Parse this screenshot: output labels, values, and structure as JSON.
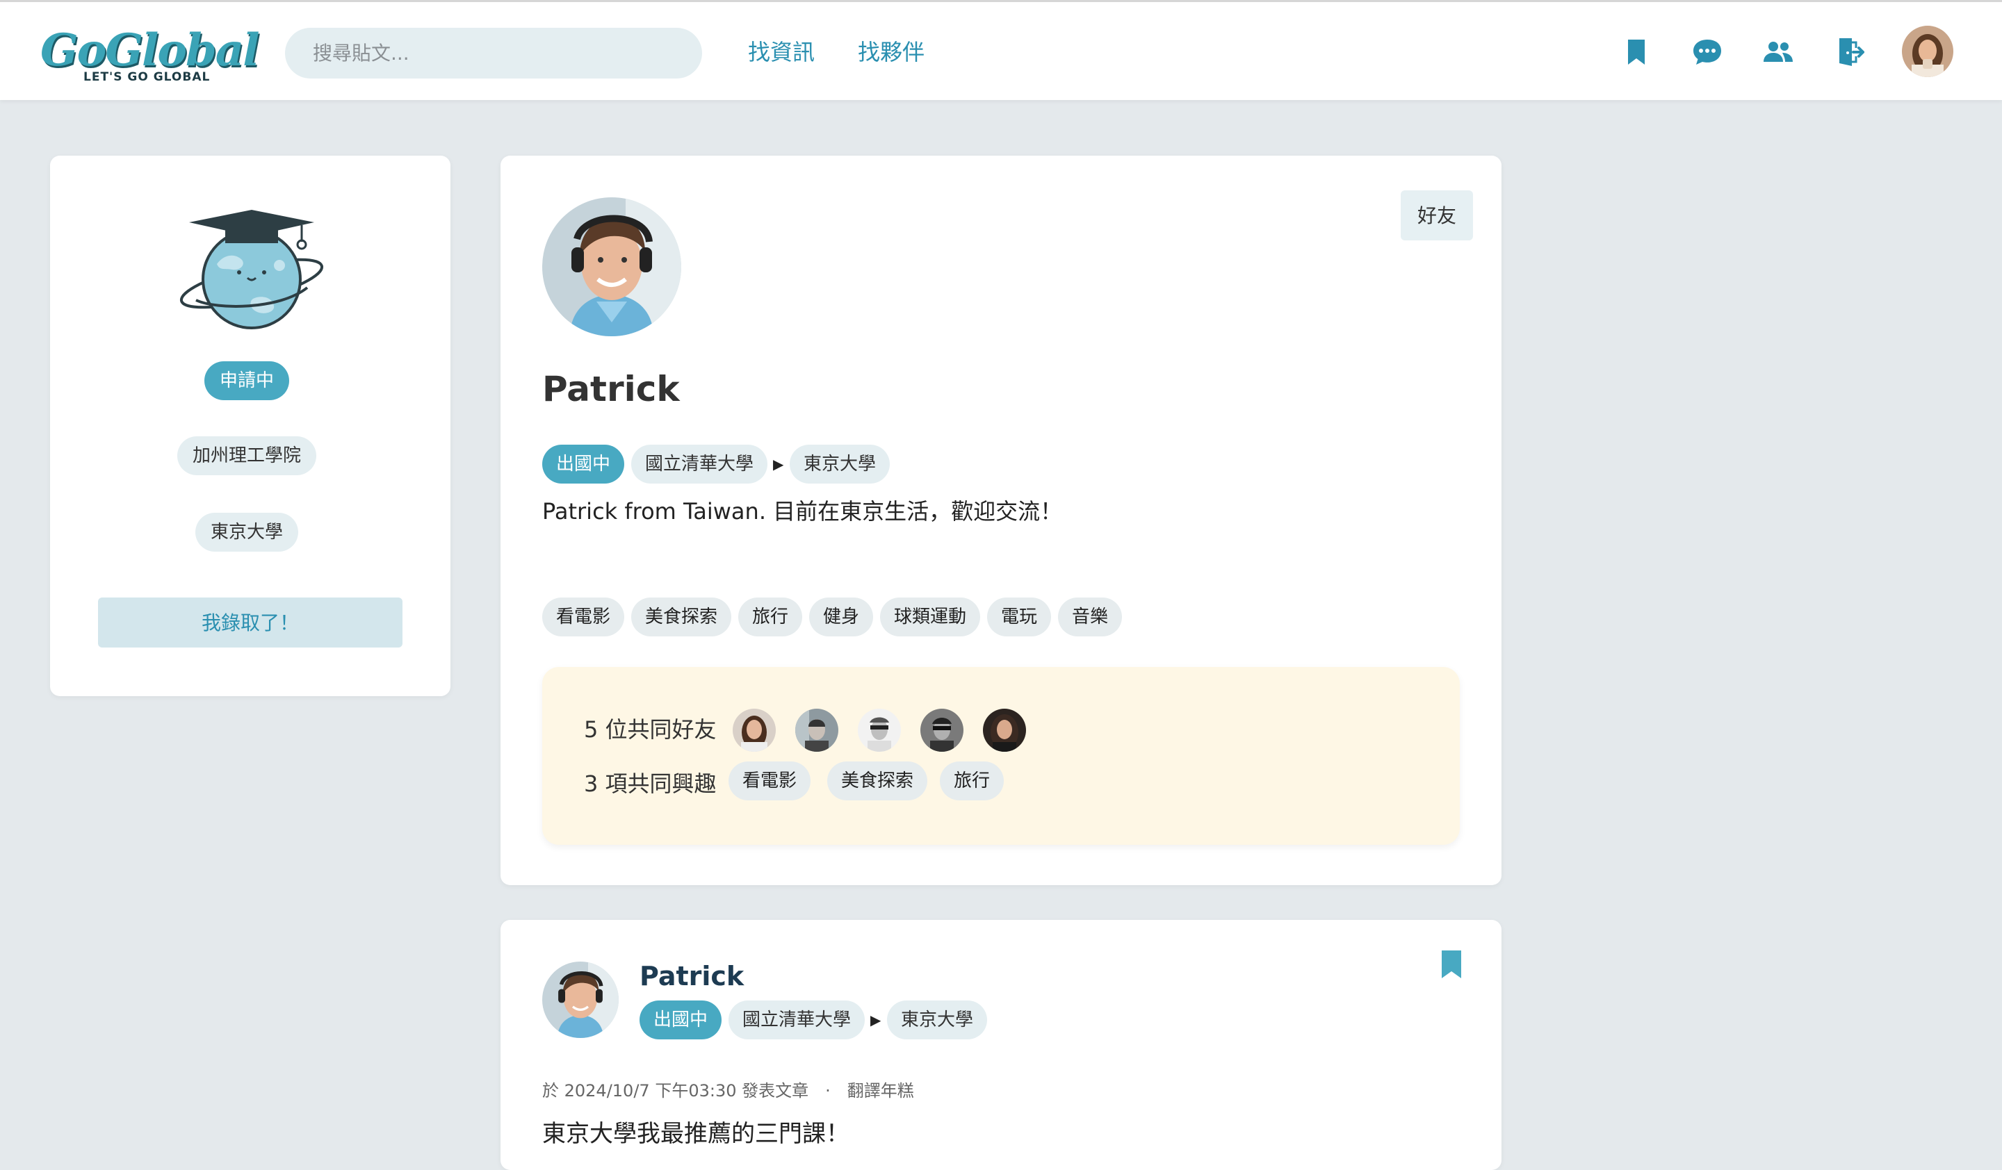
{
  "header": {
    "logo_text": "GoGlobal",
    "logo_tagline": "LET'S GO GLOBAL",
    "search_placeholder": "搜尋貼文...",
    "nav": [
      "找資訊",
      "找夥伴"
    ],
    "icons": [
      "bookmark-icon",
      "chat-icon",
      "friends-icon",
      "logout-icon"
    ],
    "accent_color": "#2a8fb0"
  },
  "sidebar": {
    "status": "申請中",
    "school_from": "加州理工學院",
    "school_to": "東京大學",
    "accept_button": "我錄取了！"
  },
  "profile": {
    "friend_button": "好友",
    "name": "Patrick",
    "status": "出國中",
    "school_from": "國立清華大學",
    "school_to": "東京大學",
    "bio": "Patrick from Taiwan. 目前在東京生活，歡迎交流！",
    "interests": [
      "看電影",
      "美食探索",
      "旅行",
      "健身",
      "球類運動",
      "電玩",
      "音樂"
    ],
    "common": {
      "friends_label": "5 位共同好友",
      "interests_label": "3 項共同興趣",
      "interests": [
        "看電影",
        "美食探索",
        "旅行"
      ]
    }
  },
  "post": {
    "author": "Patrick",
    "status": "出國中",
    "school_from": "國立清華大學",
    "school_to": "東京大學",
    "meta": "於 2024/10/7 下午03:30 發表文章　·　翻譯年糕",
    "title": "東京大學我最推薦的三門課！"
  }
}
